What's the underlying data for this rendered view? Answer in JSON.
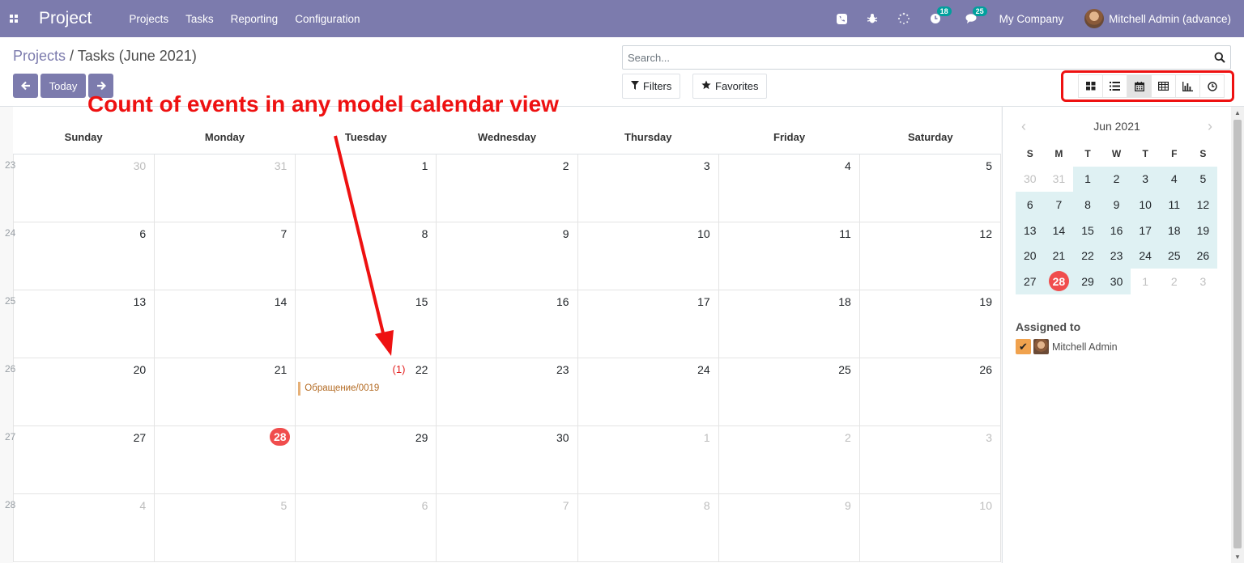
{
  "navbar": {
    "app_title": "Project",
    "menu": [
      "Projects",
      "Tasks",
      "Reporting",
      "Configuration"
    ],
    "activity_count": "18",
    "message_count": "25",
    "company": "My Company",
    "user": "Mitchell Admin (advance)"
  },
  "breadcrumb": {
    "parent": "Projects",
    "separator": "/",
    "current": "Tasks (June 2021)"
  },
  "controls": {
    "today_label": "Today",
    "search_placeholder": "Search...",
    "filters_label": "Filters",
    "favorites_label": "Favorites",
    "views": [
      "kanban-icon",
      "list-icon",
      "calendar-icon",
      "pivot-icon",
      "graph-icon",
      "activity-icon"
    ],
    "active_view": "calendar-icon"
  },
  "annotation": "Count of events in any model calendar view",
  "calendar": {
    "days": [
      "Sunday",
      "Monday",
      "Tuesday",
      "Wednesday",
      "Thursday",
      "Friday",
      "Saturday"
    ],
    "weeks": [
      {
        "week": "23",
        "dates": [
          "30",
          "31",
          "1",
          "2",
          "3",
          "4",
          "5"
        ],
        "other": [
          true,
          true,
          false,
          false,
          false,
          false,
          false
        ]
      },
      {
        "week": "24",
        "dates": [
          "6",
          "7",
          "8",
          "9",
          "10",
          "11",
          "12"
        ],
        "other": [
          false,
          false,
          false,
          false,
          false,
          false,
          false
        ]
      },
      {
        "week": "25",
        "dates": [
          "13",
          "14",
          "15",
          "16",
          "17",
          "18",
          "19"
        ],
        "other": [
          false,
          false,
          false,
          false,
          false,
          false,
          false
        ]
      },
      {
        "week": "26",
        "dates": [
          "20",
          "21",
          "22",
          "23",
          "24",
          "25",
          "26"
        ],
        "other": [
          false,
          false,
          false,
          false,
          false,
          false,
          false
        ]
      },
      {
        "week": "27",
        "dates": [
          "27",
          "28",
          "29",
          "30",
          "1",
          "2",
          "3"
        ],
        "other": [
          false,
          false,
          false,
          false,
          true,
          true,
          true
        ]
      },
      {
        "week": "28",
        "dates": [
          "4",
          "5",
          "6",
          "7",
          "8",
          "9",
          "10"
        ],
        "other": [
          true,
          true,
          true,
          true,
          true,
          true,
          true
        ]
      }
    ],
    "today": "28",
    "event": {
      "date": "22",
      "count": "(1)",
      "title": "Обращение/0019"
    },
    "event_color": "#e6b077"
  },
  "mini_calendar": {
    "month": "Jun 2021",
    "dow": [
      "S",
      "M",
      "T",
      "W",
      "T",
      "F",
      "S"
    ],
    "rows": [
      [
        "30",
        "31",
        "1",
        "2",
        "3",
        "4",
        "5"
      ],
      [
        "6",
        "7",
        "8",
        "9",
        "10",
        "11",
        "12"
      ],
      [
        "13",
        "14",
        "15",
        "16",
        "17",
        "18",
        "19"
      ],
      [
        "20",
        "21",
        "22",
        "23",
        "24",
        "25",
        "26"
      ],
      [
        "27",
        "28",
        "29",
        "30",
        "1",
        "2",
        "3"
      ]
    ],
    "today": "28"
  },
  "filters_panel": {
    "title": "Assigned to",
    "attendee": "Mitchell Admin"
  },
  "colors": {
    "brand": "#7c7bad",
    "highlight": "#ee1111",
    "today": "#f04d4d",
    "mini_fill": "#dff1f3"
  }
}
